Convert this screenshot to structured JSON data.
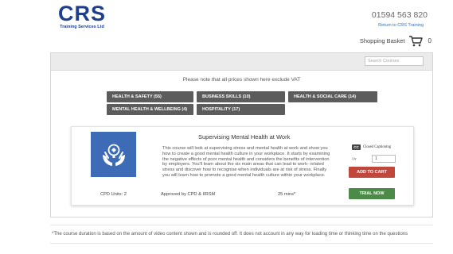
{
  "header": {
    "logo_text": "CRS",
    "logo_subtext": "Training Services Ltd",
    "phone": "01594 563 820",
    "return_link": "Return to CRS Training",
    "basket_label": "Shopping Basket",
    "basket_count": "0"
  },
  "search": {
    "placeholder": "Search Courses"
  },
  "vat_note": "Please note that all prices shown here exclude VAT",
  "categories": [
    {
      "label": "HEALTH & SAFETY (55)"
    },
    {
      "label": "BUSINESS SKILLS (10)"
    },
    {
      "label": "HEALTH & SOCIAL CARE (14)"
    },
    {
      "label": "MENTAL HEALTH & WELLBEING (4)"
    },
    {
      "label": "HOSPITALITY (17)"
    }
  ],
  "course": {
    "title": "Supervising Mental Health at Work",
    "description": "This course will look at supervising stress and mental health at work and show you how to create a good mental health culture in your workplace. It starts by examining the negative effects of poor mental health and considers the benefits of intervention by employers. You'll learn about the six main areas that can lead to work- related stress and discover how to recognise when individuals are at risk of stress. Finally you will learn how to promote a good mental health culture within your workplace.",
    "cpd_units": "CPD Units: 2",
    "approved": "Approved by CPD & IIRSM",
    "duration": "25 mins*",
    "cc_badge": "CC",
    "cc_label": "Closed Captioning",
    "qty_label": "Qty",
    "qty_value": "1",
    "add_to_cart": "ADD TO CART",
    "trial": "TRIAL NOW"
  },
  "footnote": "*The course duration is based on the amount of video content shown and is rounded off. It does not account in any way for loading time or thinking time on the questions",
  "colors": {
    "brand_blue": "#1f3f8c",
    "category_bg": "#5c5c5c",
    "add_to_cart": "#c1473d",
    "trial": "#4c8a47",
    "course_image": "#3d6bb5"
  }
}
